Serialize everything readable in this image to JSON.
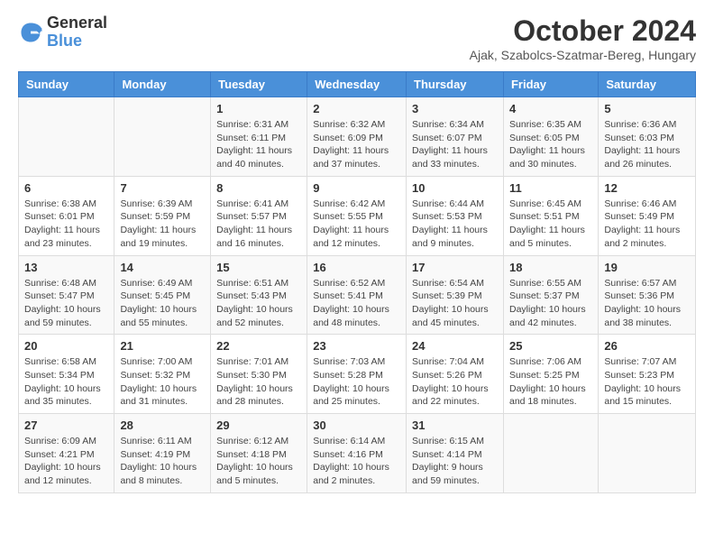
{
  "logo": {
    "general": "General",
    "blue": "Blue"
  },
  "title": "October 2024",
  "location": "Ajak, Szabolcs-Szatmar-Bereg, Hungary",
  "days_of_week": [
    "Sunday",
    "Monday",
    "Tuesday",
    "Wednesday",
    "Thursday",
    "Friday",
    "Saturday"
  ],
  "weeks": [
    [
      {
        "day": "",
        "info": ""
      },
      {
        "day": "",
        "info": ""
      },
      {
        "day": "1",
        "info": "Sunrise: 6:31 AM\nSunset: 6:11 PM\nDaylight: 11 hours and 40 minutes."
      },
      {
        "day": "2",
        "info": "Sunrise: 6:32 AM\nSunset: 6:09 PM\nDaylight: 11 hours and 37 minutes."
      },
      {
        "day": "3",
        "info": "Sunrise: 6:34 AM\nSunset: 6:07 PM\nDaylight: 11 hours and 33 minutes."
      },
      {
        "day": "4",
        "info": "Sunrise: 6:35 AM\nSunset: 6:05 PM\nDaylight: 11 hours and 30 minutes."
      },
      {
        "day": "5",
        "info": "Sunrise: 6:36 AM\nSunset: 6:03 PM\nDaylight: 11 hours and 26 minutes."
      }
    ],
    [
      {
        "day": "6",
        "info": "Sunrise: 6:38 AM\nSunset: 6:01 PM\nDaylight: 11 hours and 23 minutes."
      },
      {
        "day": "7",
        "info": "Sunrise: 6:39 AM\nSunset: 5:59 PM\nDaylight: 11 hours and 19 minutes."
      },
      {
        "day": "8",
        "info": "Sunrise: 6:41 AM\nSunset: 5:57 PM\nDaylight: 11 hours and 16 minutes."
      },
      {
        "day": "9",
        "info": "Sunrise: 6:42 AM\nSunset: 5:55 PM\nDaylight: 11 hours and 12 minutes."
      },
      {
        "day": "10",
        "info": "Sunrise: 6:44 AM\nSunset: 5:53 PM\nDaylight: 11 hours and 9 minutes."
      },
      {
        "day": "11",
        "info": "Sunrise: 6:45 AM\nSunset: 5:51 PM\nDaylight: 11 hours and 5 minutes."
      },
      {
        "day": "12",
        "info": "Sunrise: 6:46 AM\nSunset: 5:49 PM\nDaylight: 11 hours and 2 minutes."
      }
    ],
    [
      {
        "day": "13",
        "info": "Sunrise: 6:48 AM\nSunset: 5:47 PM\nDaylight: 10 hours and 59 minutes."
      },
      {
        "day": "14",
        "info": "Sunrise: 6:49 AM\nSunset: 5:45 PM\nDaylight: 10 hours and 55 minutes."
      },
      {
        "day": "15",
        "info": "Sunrise: 6:51 AM\nSunset: 5:43 PM\nDaylight: 10 hours and 52 minutes."
      },
      {
        "day": "16",
        "info": "Sunrise: 6:52 AM\nSunset: 5:41 PM\nDaylight: 10 hours and 48 minutes."
      },
      {
        "day": "17",
        "info": "Sunrise: 6:54 AM\nSunset: 5:39 PM\nDaylight: 10 hours and 45 minutes."
      },
      {
        "day": "18",
        "info": "Sunrise: 6:55 AM\nSunset: 5:37 PM\nDaylight: 10 hours and 42 minutes."
      },
      {
        "day": "19",
        "info": "Sunrise: 6:57 AM\nSunset: 5:36 PM\nDaylight: 10 hours and 38 minutes."
      }
    ],
    [
      {
        "day": "20",
        "info": "Sunrise: 6:58 AM\nSunset: 5:34 PM\nDaylight: 10 hours and 35 minutes."
      },
      {
        "day": "21",
        "info": "Sunrise: 7:00 AM\nSunset: 5:32 PM\nDaylight: 10 hours and 31 minutes."
      },
      {
        "day": "22",
        "info": "Sunrise: 7:01 AM\nSunset: 5:30 PM\nDaylight: 10 hours and 28 minutes."
      },
      {
        "day": "23",
        "info": "Sunrise: 7:03 AM\nSunset: 5:28 PM\nDaylight: 10 hours and 25 minutes."
      },
      {
        "day": "24",
        "info": "Sunrise: 7:04 AM\nSunset: 5:26 PM\nDaylight: 10 hours and 22 minutes."
      },
      {
        "day": "25",
        "info": "Sunrise: 7:06 AM\nSunset: 5:25 PM\nDaylight: 10 hours and 18 minutes."
      },
      {
        "day": "26",
        "info": "Sunrise: 7:07 AM\nSunset: 5:23 PM\nDaylight: 10 hours and 15 minutes."
      }
    ],
    [
      {
        "day": "27",
        "info": "Sunrise: 6:09 AM\nSunset: 4:21 PM\nDaylight: 10 hours and 12 minutes."
      },
      {
        "day": "28",
        "info": "Sunrise: 6:11 AM\nSunset: 4:19 PM\nDaylight: 10 hours and 8 minutes."
      },
      {
        "day": "29",
        "info": "Sunrise: 6:12 AM\nSunset: 4:18 PM\nDaylight: 10 hours and 5 minutes."
      },
      {
        "day": "30",
        "info": "Sunrise: 6:14 AM\nSunset: 4:16 PM\nDaylight: 10 hours and 2 minutes."
      },
      {
        "day": "31",
        "info": "Sunrise: 6:15 AM\nSunset: 4:14 PM\nDaylight: 9 hours and 59 minutes."
      },
      {
        "day": "",
        "info": ""
      },
      {
        "day": "",
        "info": ""
      }
    ]
  ]
}
